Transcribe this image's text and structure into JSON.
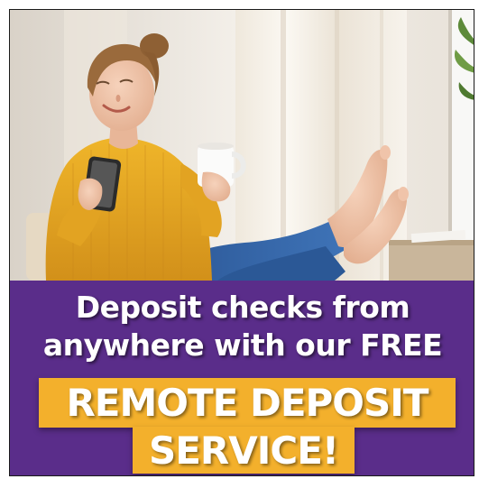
{
  "headline": {
    "line1": "Deposit checks from",
    "line2": "anywhere with our FREE",
    "highlight1": "REMOTE DEPOSIT",
    "highlight2": "SERVICE!"
  },
  "colors": {
    "panel": "#5a2d8a",
    "highlight": "#f3b02c",
    "text": "#ffffff",
    "sweater": "#e3a41f",
    "jeans": "#2f5f9e"
  },
  "photo": {
    "subject": "smiling woman in yellow sweater holding phone and coffee mug, feet up",
    "icons": [
      "smartphone-icon",
      "coffee-mug-icon",
      "plant-icon"
    ]
  }
}
